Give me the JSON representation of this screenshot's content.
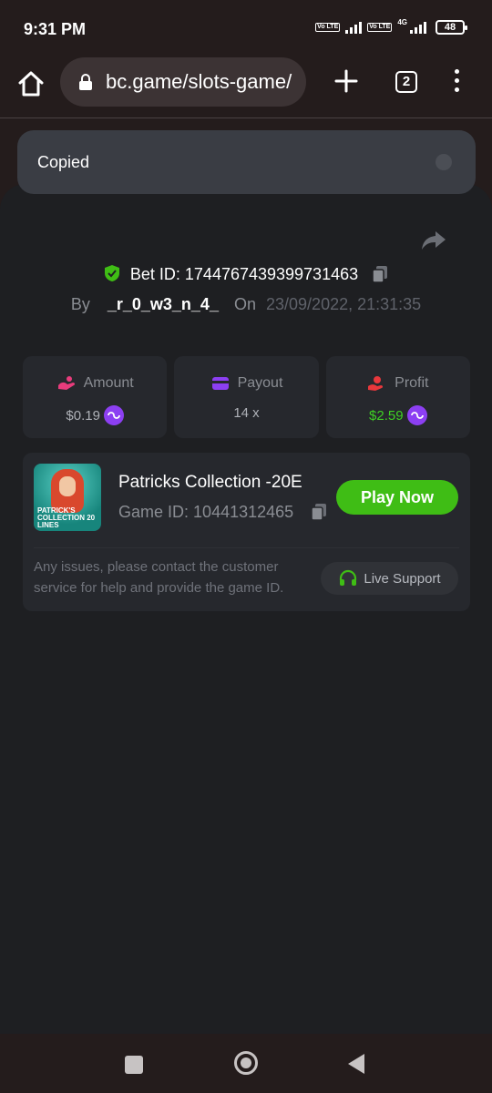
{
  "status_bar": {
    "time": "9:31 PM",
    "volte1": "Vo LTE",
    "volte2": "Vo LTE",
    "network": "4G",
    "battery": "48"
  },
  "browser": {
    "url": "bc.game/slots-game/",
    "tab_count": "2"
  },
  "toast": {
    "message": "Copied"
  },
  "bet": {
    "label": "Bet ID:",
    "id": "1744767439399731463",
    "by_label": "By",
    "user": "_r_0_w3_n_4_",
    "on_label": "On",
    "date": "23/09/2022, 21:31:35"
  },
  "stats": {
    "amount_label": "Amount",
    "amount_value": "$0.19",
    "payout_label": "Payout",
    "payout_value": "14 x",
    "profit_label": "Profit",
    "profit_value": "$2.59"
  },
  "game": {
    "title": "Patricks Collection -20E",
    "game_id_label": "Game ID:",
    "game_id": "10441312465",
    "play_label": "Play Now",
    "thumb_text": "PATRICK'S COLLECTION 20 LINES",
    "help_text": "Any issues, please contact the customer service for help and provide the game ID.",
    "support_label": "Live Support"
  },
  "colors": {
    "accent_green": "#3fbd15",
    "profit_green": "#3fd024",
    "coin_purple": "#8c3ff2",
    "panel_bg": "#1e1f22"
  }
}
